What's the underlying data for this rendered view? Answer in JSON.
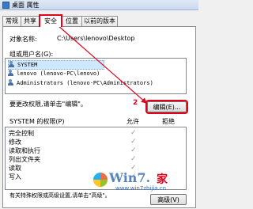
{
  "window": {
    "title": "桌面 属性"
  },
  "tabs": [
    {
      "label": "常规"
    },
    {
      "label": "共享"
    },
    {
      "label": "安全"
    },
    {
      "label": "位置"
    },
    {
      "label": "以前的版本"
    }
  ],
  "object": {
    "label": "对象名称:",
    "value": "C:\\Users\\lenovo\\Desktop"
  },
  "groups": {
    "label": "组或用户名(G):",
    "items": [
      {
        "name": "SYSTEM"
      },
      {
        "name": "lenovo (lenovo-PC\\lenovo)"
      },
      {
        "name": "Administrators (lenovo-PC\\Administrators)"
      }
    ]
  },
  "change_text": "要更改权限,请单击\"编辑\"。",
  "edit_button": "编辑(E)...",
  "annotation_number": "2",
  "permissions": {
    "header": "SYSTEM 的权限(P)",
    "allow": "允许",
    "deny": "拒绝",
    "items": [
      {
        "name": "完全控制",
        "allow": true
      },
      {
        "name": "修改",
        "allow": true
      },
      {
        "name": "读取和执行",
        "allow": true
      },
      {
        "name": "列出文件夹",
        "allow": true
      },
      {
        "name": "读取",
        "allow": true
      },
      {
        "name": "写入",
        "allow": true
      }
    ]
  },
  "special_text": "有关特殊权限或高级设置,请单击\"高级\"。",
  "advanced_button": "高级(V)",
  "watermark": {
    "brand": "Win7.",
    "brand2": "家",
    "url": "www.win7zhijia.cn"
  },
  "accent_color": "#e3001b"
}
